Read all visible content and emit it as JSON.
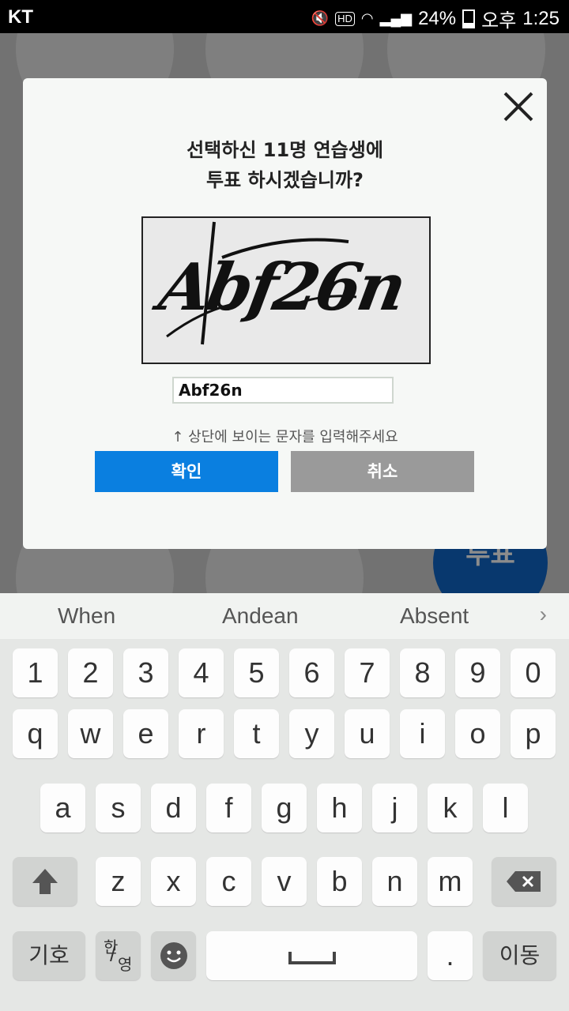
{
  "status": {
    "carrier": "KT",
    "battery": "24%",
    "ampm": "오후",
    "time": "1:25",
    "hd": "HD"
  },
  "background": {
    "vote_label": "투표"
  },
  "dialog": {
    "title_line1": "선택하신 11명 연습생에",
    "title_line2": "투표 하시겠습니까?",
    "captcha_text": "Abf26n",
    "answer_value": "Abf26n",
    "hint": "↑ 상단에 보이는 문자를 입력해주세요",
    "ok_label": "확인",
    "cancel_label": "취소"
  },
  "keyboard": {
    "suggestions": [
      "When",
      "Andean",
      "Absent"
    ],
    "row_numbers": [
      "1",
      "2",
      "3",
      "4",
      "5",
      "6",
      "7",
      "8",
      "9",
      "0"
    ],
    "row1": [
      "q",
      "w",
      "e",
      "r",
      "t",
      "y",
      "u",
      "i",
      "o",
      "p"
    ],
    "row2": [
      "a",
      "s",
      "d",
      "f",
      "g",
      "h",
      "j",
      "k",
      "l"
    ],
    "row3": [
      "z",
      "x",
      "c",
      "v",
      "b",
      "n",
      "m"
    ],
    "symbols_label": "기호",
    "lang_label_top": "한",
    "lang_label_bottom": "영",
    "period_label": ".",
    "move_label": "이동"
  }
}
